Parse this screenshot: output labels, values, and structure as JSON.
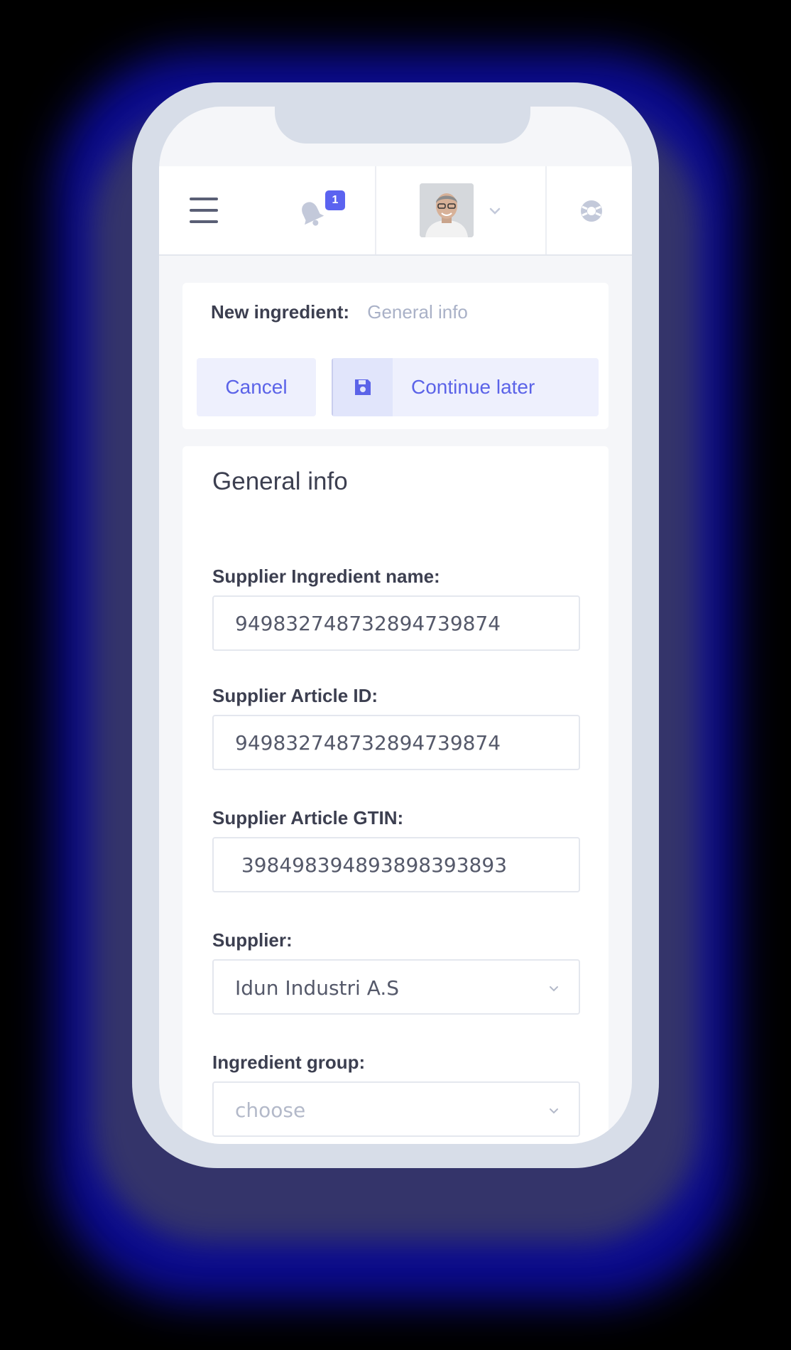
{
  "navbar": {
    "menu_icon": "hamburger-menu-icon",
    "notifications": {
      "icon": "bell-icon",
      "count": "1"
    },
    "profile": {
      "avatar_icon": "user-avatar",
      "caret_icon": "chevron-down-icon"
    },
    "help_icon": "lifebuoy-icon"
  },
  "header": {
    "title": "New ingredient:",
    "step": "General info",
    "cancel_label": "Cancel",
    "continue_label": "Continue later",
    "continue_icon": "floppy-disk-icon"
  },
  "form": {
    "title": "General info",
    "fields": [
      {
        "label": "Supplier Ingredient name:",
        "value": "949832748732894739874"
      },
      {
        "label": "Supplier Article ID:",
        "value": "949832748732894739874"
      },
      {
        "label": "Supplier Article GTIN:",
        "value": " 398498394893898393893"
      },
      {
        "label": "Supplier:",
        "value": "Idun Industri A.S",
        "type": "select"
      },
      {
        "label": "Ingredient group:",
        "value": "",
        "placeholder": "choose",
        "type": "select"
      }
    ]
  },
  "colors": {
    "accent": "#5b63e8",
    "accent_light": "#eef0fd",
    "text": "#3c3f50",
    "muted": "#a9b1c7"
  }
}
